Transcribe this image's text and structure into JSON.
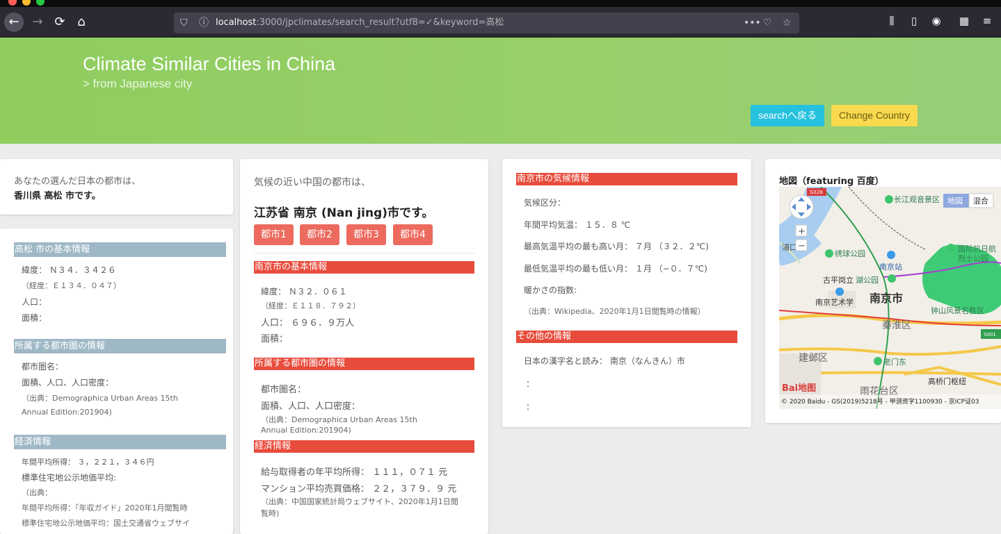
{
  "browser": {
    "url_host": "localhost",
    "url_rest": ":3000/jpclimates/search_result?utf8=✓&keyword=高松",
    "page_actions": "•••"
  },
  "header": {
    "title": "Climate Similar Cities in China",
    "subtitle": "> from Japanese city",
    "search_button": "searchへ戻る",
    "country_button": "Change Country"
  },
  "japan_city": {
    "intro": "あなたの選んだ日本の都市は、",
    "selected": "香川県 高松 市です。",
    "basic_title": "高松 市の基本情報",
    "latitude": "緯度： Ｎ３４．３４２６",
    "longitude": "（経度：Ｅ１３４．０４７）",
    "population": "人口：",
    "area": "面積：",
    "metro_title": "所属する都市圏の情報",
    "metro_name": "都市圏名：",
    "metro_stats": "面積、人口、人口密度：",
    "metro_source_1": "（出典：Demographica Urban Areas 15th",
    "metro_source_2": "Annual Edition:201904)",
    "econ_title": "経済情報",
    "income": "年間平均所得： ３，２２１，３４６円",
    "land_price": "標準住宅地公示地価平均:",
    "econ_source": "（出典：",
    "income_source": "年間平均所得：「年収ガイド」2020年1月閲覧時",
    "land_source": "標準住宅地公示地価平均：国土交通省ウェブサイ"
  },
  "china_city": {
    "intro": "気候の近い中国の都市は、",
    "result": "江苏省 南京 (Nan jing)市です。",
    "buttons": [
      "都市1",
      "都市2",
      "都市3",
      "都市4"
    ],
    "basic_title": "南京市の基本情報",
    "latitude": "緯度： Ｎ３２．０６１",
    "longitude": "（経度：Ｅ１１８．７９２）",
    "population": "人口： ６９６．９万人",
    "area": "面積：",
    "metro_title": "所属する都市圏の情報",
    "metro_name": "都市圏名：",
    "metro_stats": "面積、人口、人口密度：",
    "metro_source_1": "（出典：Demographica Urban Areas 15th",
    "metro_source_2": "Annual Edition:201904)",
    "econ_title": "経済情報",
    "income": "給与取得者の年平均所得： １１１，０７１ 元",
    "condo_price": "マンション平均売買価格： ２２，３７９．９ 元",
    "econ_source_1": "（出典：中国国家統計局ウェブサイト、2020年1月1日閲",
    "econ_source_2": "覧時)"
  },
  "climate": {
    "title": "南京市の気候情報",
    "zone": "気候区分：",
    "avg_temp": "年間平均気温： １５．８ ℃",
    "hottest": "最高気温平均の最も高い月： ７月 （３２．２℃)",
    "coldest": "最低気温平均の最も低い月： １月 （−０．７℃)",
    "warmth": "暖かさの指数:",
    "source": "（出典：Wikipedia、2020年1月1日閲覧時の情報）",
    "other_title": "その他の情報",
    "kanji_reading": "日本の漢字名と読み： 南京（なんきん）市",
    "line2": "：",
    "line3": "："
  },
  "map": {
    "title": "地図（featuring 百度）",
    "type_map": "地図",
    "type_hybrid": "混合",
    "zoom_in": "+",
    "zoom_out": "−",
    "city_label": "南京市",
    "labels": [
      "长江观音景区",
      "浦口区",
      "绣球公园",
      "南京站",
      "国际抗日航",
      "烈士公园",
      "古平岗立",
      "湖公园",
      "南京艺术学",
      "钟山风景名胜区",
      "秦淮区",
      "老门东",
      "建邺区",
      "高桥门枢纽",
      "雨花台区"
    ],
    "road_g328": "G328",
    "road_s001": "S001",
    "logo": "Bai地图",
    "copyright": "© 2020 Baidu - GS(2019)5218号 - 甲测资字1100930 - 京ICP证03"
  }
}
